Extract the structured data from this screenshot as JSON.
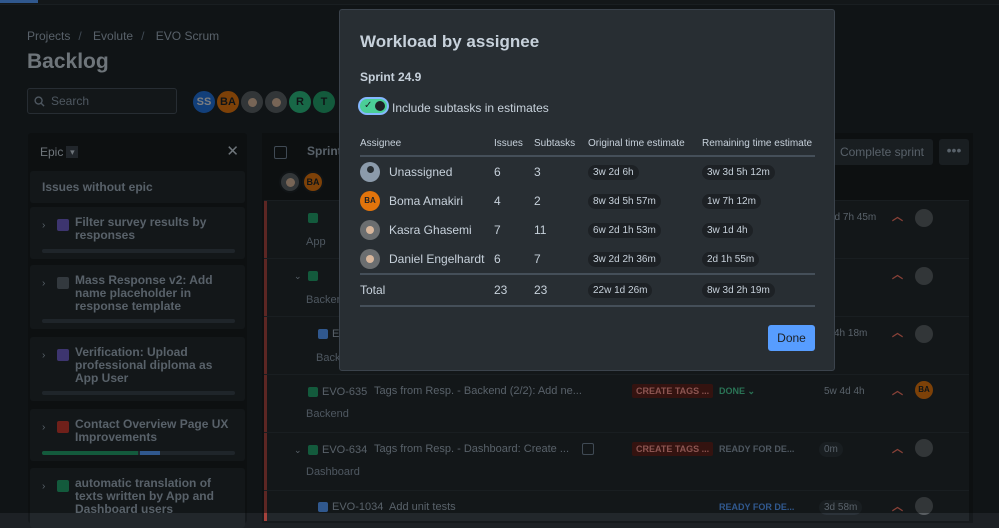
{
  "breadcrumb": [
    "Projects",
    "Evolute",
    "EVO Scrum"
  ],
  "page_title": "Backlog",
  "search": {
    "placeholder": "Search"
  },
  "avatars": [
    {
      "initials": "SS",
      "color": "#1f6fdb"
    },
    {
      "initials": "BA",
      "color": "#e2740b"
    },
    {
      "initials": "",
      "color": ""
    },
    {
      "initials": "",
      "color": ""
    },
    {
      "initials": "R",
      "color": "#2abb7f"
    },
    {
      "initials": "T",
      "color": "#22a06b"
    }
  ],
  "epic_panel": {
    "header": "Epic",
    "no_epic": "Issues without epic",
    "epics": [
      {
        "name": "Filter survey results by responses",
        "color": "#6e5dc6"
      },
      {
        "name": "Mass Response v2: Add name placeholder in response template",
        "color": "#5c646d"
      },
      {
        "name": "Verification: Upload professional diploma as App User",
        "color": "#6e5dc6"
      },
      {
        "name": "Contact Overview Page UX Improvements",
        "color": "#c9372c"
      },
      {
        "name": "automatic translation of texts written by App and Dashboard users",
        "color": "#22a06b"
      }
    ]
  },
  "sprint": {
    "name": "Sprint",
    "complete_button": "Complete sprint",
    "more": "•••",
    "rows": [
      {
        "sub": "App",
        "time": "4d 7h 45m"
      },
      {
        "sub": "Backen",
        "time": ""
      },
      {
        "key": "EVO",
        "sub": "Back",
        "time": "4h 18m"
      },
      {
        "key": "EVO-635",
        "summary": "Tags from Resp. - Backend (2/2): Add ne...",
        "epic": "CREATE TAGS ...",
        "status": "DONE",
        "sub": "Backend",
        "time": "5w 4d 4h",
        "assignee": "BA"
      },
      {
        "key": "EVO-634",
        "summary": "Tags from Resp. - Dashboard: Create ...",
        "epic": "CREATE TAGS ...",
        "status": "READY FOR DE...",
        "sub": "Dashboard",
        "time": "0m"
      },
      {
        "key": "EVO-1034",
        "summary": "Add unit tests",
        "status": "READY FOR DE...",
        "time": "3d 58m"
      }
    ]
  },
  "modal": {
    "title": "Workload by assignee",
    "sprint": "Sprint 24.9",
    "toggle_label": "Include subtasks in estimates",
    "columns": [
      "Assignee",
      "Issues",
      "Subtasks",
      "Original time estimate",
      "Remaining time estimate"
    ],
    "rows": [
      {
        "name": "Unassigned",
        "issues": "6",
        "subtasks": "3",
        "original": "3w 2d 6h",
        "remaining": "3w 3d 5h 12m"
      },
      {
        "name": "Boma Amakiri",
        "initials": "BA",
        "issues": "4",
        "subtasks": "2",
        "original": "8w 3d 5h 57m",
        "remaining": "1w 7h 12m"
      },
      {
        "name": "Kasra Ghasemi",
        "issues": "7",
        "subtasks": "11",
        "original": "6w 2d 1h 53m",
        "remaining": "3w 1d 4h"
      },
      {
        "name": "Daniel Engelhardt",
        "issues": "6",
        "subtasks": "7",
        "original": "3w 2d 2h 36m",
        "remaining": "2d 1h 55m"
      }
    ],
    "total": {
      "label": "Total",
      "issues": "23",
      "subtasks": "23",
      "original": "22w 1d 26m",
      "remaining": "8w 3d 2h 19m"
    },
    "done_button": "Done"
  }
}
